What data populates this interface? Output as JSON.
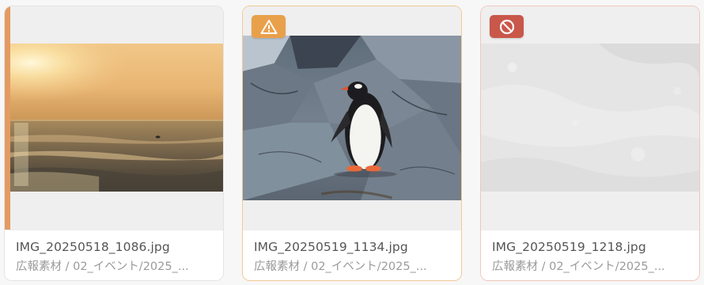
{
  "colors": {
    "selection_accent": "#e39b62",
    "warning_badge": "#e9a04a",
    "blocked_badge": "#c9574a"
  },
  "cards": [
    {
      "filename": "IMG_20250518_1086.jpg",
      "path": "広報素材 / 02_イベント/2025_...",
      "image": "sunset over ocean with surfer",
      "selected": true,
      "badge": null
    },
    {
      "filename": "IMG_20250519_1134.jpg",
      "path": "広報素材 / 02_イベント/2025_...",
      "image": "penguin standing on rocks",
      "selected": false,
      "badge": "warning-icon"
    },
    {
      "filename": "IMG_20250519_1218.jpg",
      "path": "広報素材 / 02_イベント/2025_...",
      "image": "greyed-out unavailable image",
      "selected": false,
      "badge": "blocked-icon"
    }
  ]
}
